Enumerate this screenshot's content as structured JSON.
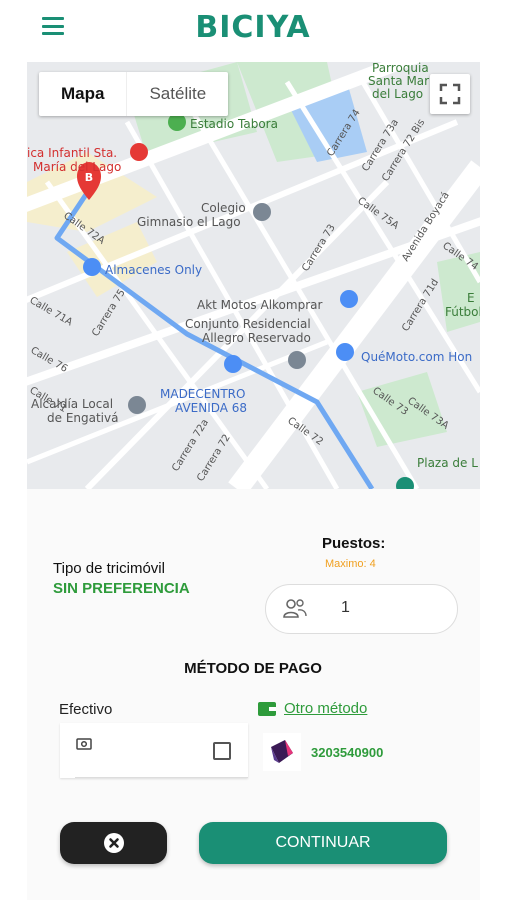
{
  "app": {
    "title": "BICIYA",
    "menu_icon": "hamburger-menu-icon",
    "brand_color": "#1a8f75"
  },
  "map": {
    "tabs": [
      {
        "label": "Mapa",
        "active": true
      },
      {
        "label": "Satélite",
        "active": false
      }
    ],
    "fullscreen_icon": "fullscreen-icon",
    "labels": {
      "stadium": "Estadio Tabora",
      "hospital_line1": "ica Infantil Sta.",
      "hospital_line2": "María del Lago",
      "church_line1": "Parroquia",
      "church_line2": "Santa María",
      "church_line3": "del Lago",
      "school_line1": "Colegio",
      "school_line2": "Gimnasio el Lago",
      "almacenes": "Almacenes Only",
      "akt": "Akt Motos Alkomprar",
      "conjunto_line1": "Conjunto Residencial",
      "conjunto_line2": "Allegro Reservado",
      "quemoto": "QuéMoto.com Hon",
      "madecentro_line1": "MADECENTRO",
      "madecentro_line2": "AVENIDA 68",
      "alcaldia_line1": "Alcaldía Local",
      "alcaldia_line2": "de Engativá",
      "plaza": "Plaza de L",
      "futbol_line1": "E",
      "futbol_line2": "Fútbol",
      "marker_b": "B",
      "avenida": "Avenida Boyacá",
      "streets": [
        "Calle 72A",
        "Calle 71A",
        "Carrera 75",
        "Calle 72",
        "Carrera 73",
        "Calle 73",
        "Calle 73A",
        "Calle 74",
        "Carrera 72a",
        "Carrera 74",
        "Carrera 73a",
        "Carrera 72 Bis",
        "Calle 75A",
        "Calle 76",
        "Carrera 71d",
        "Carrera 72",
        "Calle 71",
        "Carrera 76",
        "Calle 75",
        "Carrera 73a",
        "Carrera 72a"
      ]
    }
  },
  "trip": {
    "tipo_label": "Tipo de tricimóvil",
    "tipo_value": "SIN PREFERENCIA",
    "puestos_label": "Puestos:",
    "puestos_max": "Maximo: 4",
    "puestos_value": "1",
    "puestos_icon": "people-icon"
  },
  "payment": {
    "title": "MÉTODO DE PAGO",
    "efectivo_label": "Efectivo",
    "cash_icon": "cash-icon",
    "otro_label": "Otro método",
    "wallet_icon": "wallet-icon",
    "nequi_number": "3203540900",
    "nequi_logo": "nequi-logo"
  },
  "actions": {
    "cancel_icon": "close-circle-icon",
    "continue_label": "CONTINUAR"
  }
}
